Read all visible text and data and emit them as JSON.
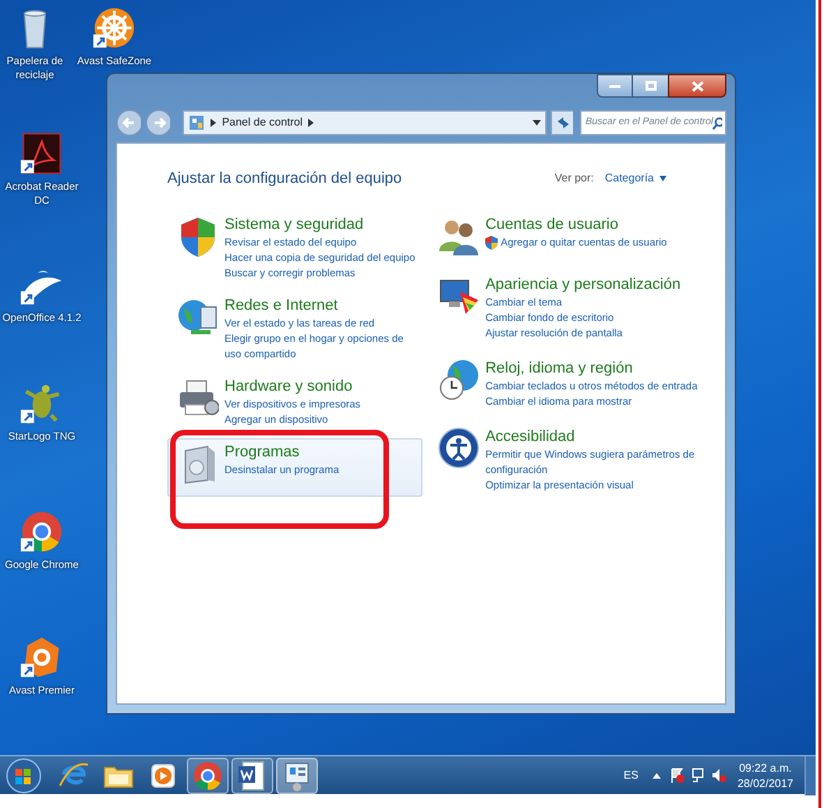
{
  "desktop_icons": [
    {
      "kind": "recycle",
      "label": "Papelera de reciclaje",
      "shortcut": false
    },
    {
      "kind": "safezone",
      "label": "Avast SafeZone",
      "shortcut": true
    },
    {
      "kind": "acrobat",
      "label": "Acrobat Reader DC",
      "shortcut": true
    },
    {
      "kind": "openoffice",
      "label": "OpenOffice 4.1.2",
      "shortcut": true
    },
    {
      "kind": "starlogo",
      "label": "StarLogo TNG",
      "shortcut": true
    },
    {
      "kind": "chrome",
      "label": "Google Chrome",
      "shortcut": true
    },
    {
      "kind": "avast",
      "label": "Avast Premier",
      "shortcut": true
    }
  ],
  "window": {
    "address": "Panel de control",
    "search": {
      "placeholder": "Buscar en el Panel de control"
    },
    "heading": "Ajustar la configuración del equipo",
    "view_by": {
      "label": "Ver por:",
      "value": "Categoría"
    },
    "columns": [
      [
        {
          "kind": "security",
          "title": "Sistema y seguridad",
          "selected": false,
          "links": [
            {
              "text": "Revisar el estado del equipo",
              "shield": false
            },
            {
              "text": "Hacer una copia de seguridad del equipo",
              "shield": false
            },
            {
              "text": "Buscar y corregir problemas",
              "shield": false
            }
          ]
        },
        {
          "kind": "network",
          "title": "Redes e Internet",
          "selected": false,
          "links": [
            {
              "text": "Ver el estado y las tareas de red",
              "shield": false
            },
            {
              "text": "Elegir grupo en el hogar y opciones de uso compartido",
              "shield": false
            }
          ]
        },
        {
          "kind": "hardware",
          "title": "Hardware y sonido",
          "selected": false,
          "links": [
            {
              "text": "Ver dispositivos e impresoras",
              "shield": false
            },
            {
              "text": "Agregar un dispositivo",
              "shield": false
            }
          ]
        },
        {
          "kind": "programs",
          "title": "Programas",
          "selected": true,
          "links": [
            {
              "text": "Desinstalar un programa",
              "shield": false
            }
          ]
        }
      ],
      [
        {
          "kind": "users",
          "title": "Cuentas de usuario",
          "selected": false,
          "links": [
            {
              "text": "Agregar o quitar cuentas de usuario",
              "shield": true
            }
          ]
        },
        {
          "kind": "appearance",
          "title": "Apariencia y personalización",
          "selected": false,
          "links": [
            {
              "text": "Cambiar el tema",
              "shield": false
            },
            {
              "text": "Cambiar fondo de escritorio",
              "shield": false
            },
            {
              "text": "Ajustar resolución de pantalla",
              "shield": false
            }
          ]
        },
        {
          "kind": "clock",
          "title": "Reloj, idioma y región",
          "selected": false,
          "links": [
            {
              "text": "Cambiar teclados u otros métodos de entrada",
              "shield": false
            },
            {
              "text": "Cambiar el idioma para mostrar",
              "shield": false
            }
          ]
        },
        {
          "kind": "access",
          "title": "Accesibilidad",
          "selected": false,
          "links": [
            {
              "text": "Permitir que Windows sugiera parámetros de configuración",
              "shield": false
            },
            {
              "text": "Optimizar la presentación visual",
              "shield": false
            }
          ]
        }
      ]
    ]
  },
  "taskbar": {
    "apps": [
      {
        "kind": "ie",
        "open": false,
        "active": false
      },
      {
        "kind": "explorer",
        "open": false,
        "active": false
      },
      {
        "kind": "media",
        "open": false,
        "active": false
      },
      {
        "kind": "chrome",
        "open": true,
        "active": false
      },
      {
        "kind": "word",
        "open": true,
        "active": false
      },
      {
        "kind": "control",
        "open": true,
        "active": true
      }
    ],
    "language": "ES",
    "time": "09:22 a.m.",
    "date": "28/02/2017"
  }
}
